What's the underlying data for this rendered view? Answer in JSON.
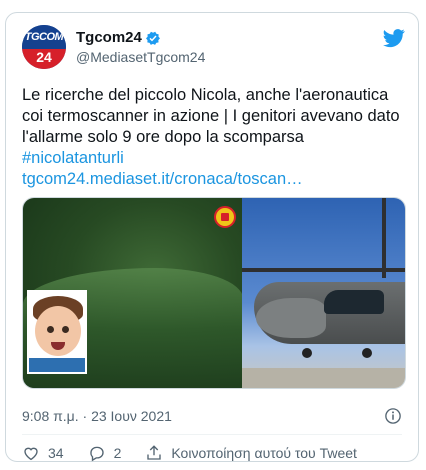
{
  "account": {
    "name": "Tgcom24",
    "handle": "@MediasetTgcom24",
    "avatar_text_top": "TGCOM",
    "avatar_text_bottom": "24"
  },
  "tweet": {
    "text": "Le ricerche del piccolo Nicola, anche l'aeronautica coi termoscanner in azione | I genitori avevano dato l'allarme solo 9 ore dopo la scomparsa ",
    "hashtag": "#nicolatanturli",
    "link": "tgcom24.mediaset.it/cronaca/toscan…",
    "timestamp": "9:08 π.μ. · 23 Ιουν 2021"
  },
  "actions": {
    "likes": "34",
    "replies": "2",
    "share_label": "Κοινοποίηση αυτού του Tweet"
  },
  "icons": {
    "verified": "verified-badge-icon",
    "twitter": "twitter-bird-icon",
    "info": "info-icon",
    "like": "heart-icon",
    "reply": "reply-icon",
    "share": "share-icon"
  },
  "colors": {
    "link": "#1b95e0",
    "twitter_blue": "#1d9bf0",
    "muted": "#536471"
  }
}
